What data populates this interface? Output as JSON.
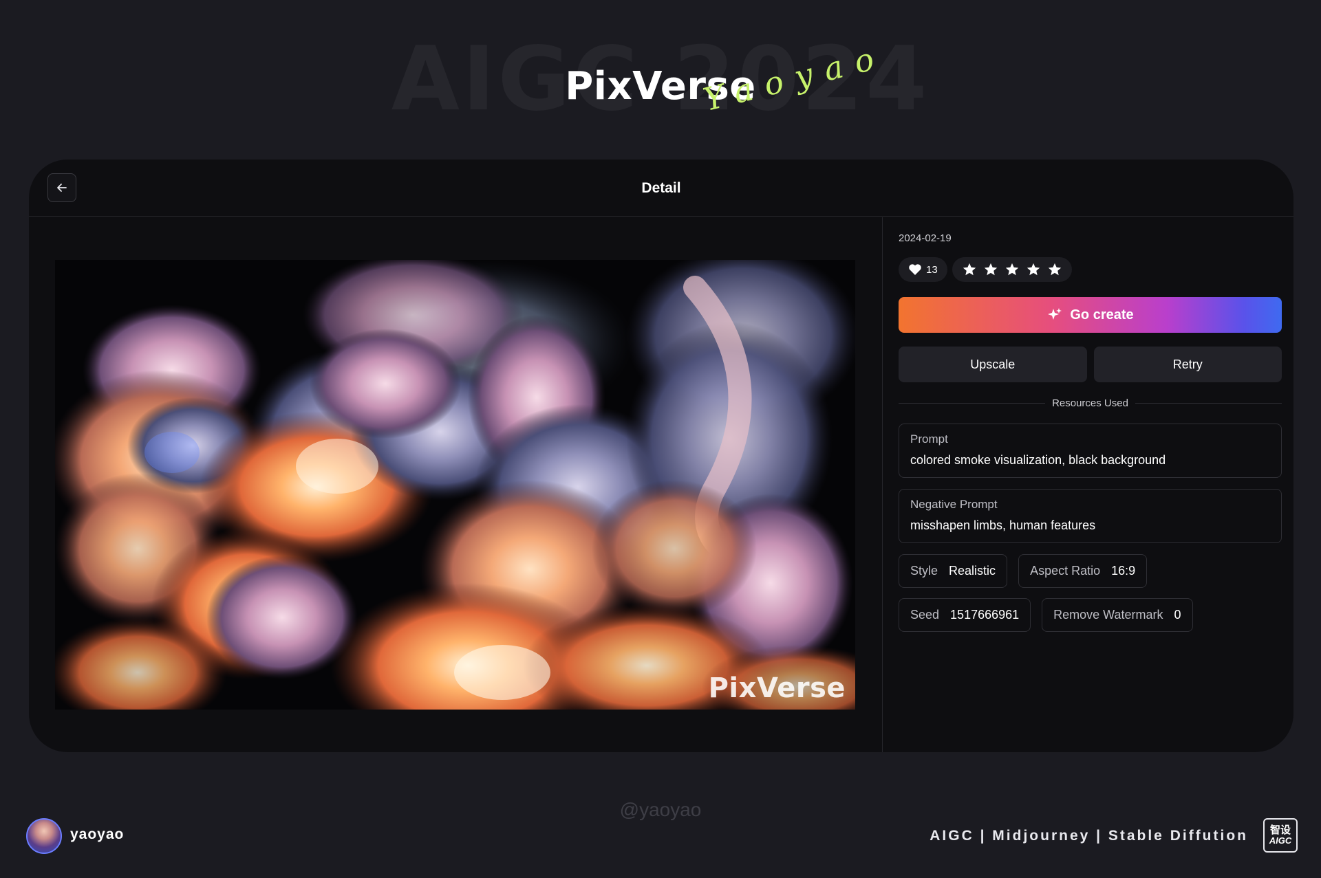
{
  "banner": {
    "bg_text": "AIGC 2024",
    "brand": "PixVerse",
    "signature": "Yaoyao"
  },
  "card": {
    "title": "Detail",
    "back_icon": "arrow-left-icon",
    "preview_watermark": "PixVerse"
  },
  "details": {
    "date": "2024-02-19",
    "likes": "13",
    "rating": 5,
    "go_create_label": "Go create",
    "upscale_label": "Upscale",
    "retry_label": "Retry",
    "resources_label": "Resources Used",
    "prompt_label": "Prompt",
    "prompt_value": "colored smoke visualization, black background",
    "negative_prompt_label": "Negative Prompt",
    "negative_prompt_value": "misshapen limbs, human features",
    "style_label": "Style",
    "style_value": "Realistic",
    "aspect_label": "Aspect Ratio",
    "aspect_value": "16:9",
    "seed_label": "Seed",
    "seed_value": "1517666961",
    "watermark_label": "Remove Watermark",
    "watermark_value": "0"
  },
  "footer": {
    "handle": "@yaoyao",
    "username": "yaoyao",
    "tagline": "AIGC | Midjourney | Stable Diffution",
    "logo_cn": "智设",
    "logo_en": "AIGC"
  },
  "colors": {
    "background": "#1b1b21",
    "card": "#0e0e11",
    "accent_gradient_start": "#f2742f",
    "accent_gradient_end": "#3f6af0",
    "signature": "#c7f26b"
  }
}
